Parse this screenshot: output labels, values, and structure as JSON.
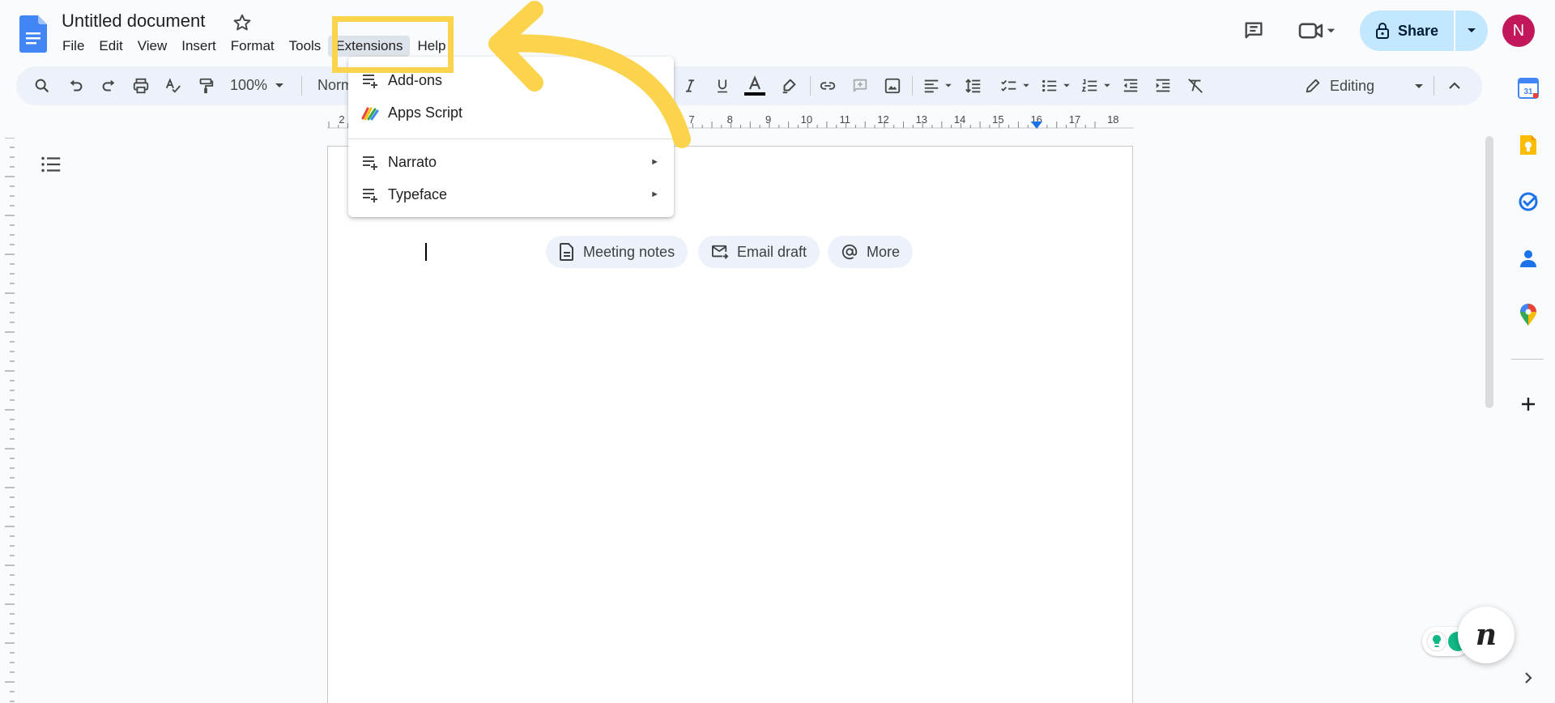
{
  "document": {
    "title": "Untitled document",
    "menu": [
      "File",
      "Edit",
      "View",
      "Insert",
      "Format",
      "Tools",
      "Extensions",
      "Help"
    ],
    "active_menu": "Extensions"
  },
  "header": {
    "share_label": "Share",
    "avatar_initial": "N",
    "icons": [
      "comments-icon",
      "meet-icon",
      "lock-icon"
    ]
  },
  "toolbar": {
    "zoom": "100%",
    "style": "Normal text",
    "style_visible": "Norm",
    "editing_mode": "Editing"
  },
  "ruler": {
    "labels": [
      "2",
      "7",
      "8",
      "9",
      "10",
      "11",
      "12",
      "13",
      "14",
      "15",
      "16",
      "17",
      "18"
    ]
  },
  "extensions_menu": {
    "items": [
      {
        "label": "Add-ons",
        "icon": "addons-icon",
        "submenu": true
      },
      {
        "label": "Apps Script",
        "icon": "apps-script-icon",
        "submenu": false
      },
      {
        "label": "Narrato",
        "icon": "addon-list-icon",
        "submenu": true
      },
      {
        "label": "Typeface",
        "icon": "addon-list-icon",
        "submenu": true
      }
    ]
  },
  "chips": [
    {
      "label": "Meeting notes",
      "icon": "document-icon"
    },
    {
      "label": "Email draft",
      "icon": "email-icon"
    },
    {
      "label": "More",
      "icon": "at-icon"
    }
  ],
  "side_panel": {
    "icons": [
      "calendar-icon",
      "keep-icon",
      "tasks-icon",
      "contacts-icon",
      "maps-icon",
      "add-icon"
    ],
    "calendar_day": "31"
  },
  "narrato_fab": "n",
  "colors": {
    "accent": "#1a73e8",
    "share_bg": "#c2e7ff",
    "avatar": "#c2185b",
    "annotation": "#fcd34d",
    "toolbar_bg": "#edf2fa"
  }
}
